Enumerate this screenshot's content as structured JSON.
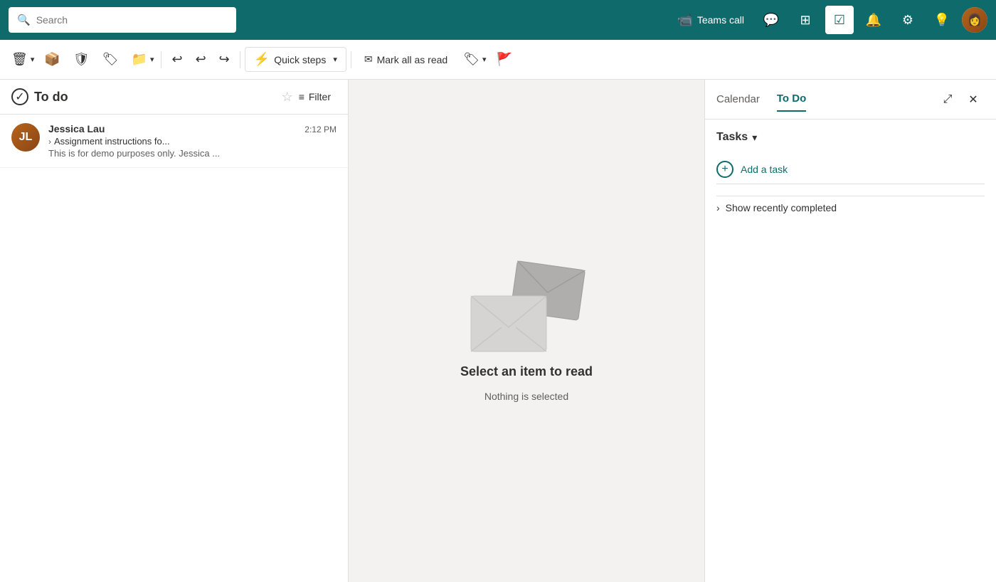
{
  "topbar": {
    "search_placeholder": "Search",
    "teams_call_label": "Teams call",
    "active_icon": "to-do-icon"
  },
  "toolbar": {
    "quick_steps_label": "Quick steps",
    "mark_all_read_label": "Mark all as read"
  },
  "mail_list": {
    "folder_name": "To do",
    "filter_label": "Filter",
    "emails": [
      {
        "sender": "Jessica Lau",
        "subject": "Assignment instructions fo...",
        "preview": "This is for demo purposes only. Jessica ...",
        "time": "2:12 PM",
        "initials": "JL"
      }
    ]
  },
  "reading_pane": {
    "empty_title": "Select an item to read",
    "empty_subtitle": "Nothing is selected"
  },
  "todo_panel": {
    "calendar_tab": "Calendar",
    "todo_tab": "To Do",
    "tasks_section_title": "Tasks",
    "add_task_label": "Add a task",
    "show_completed_label": "Show recently completed"
  }
}
